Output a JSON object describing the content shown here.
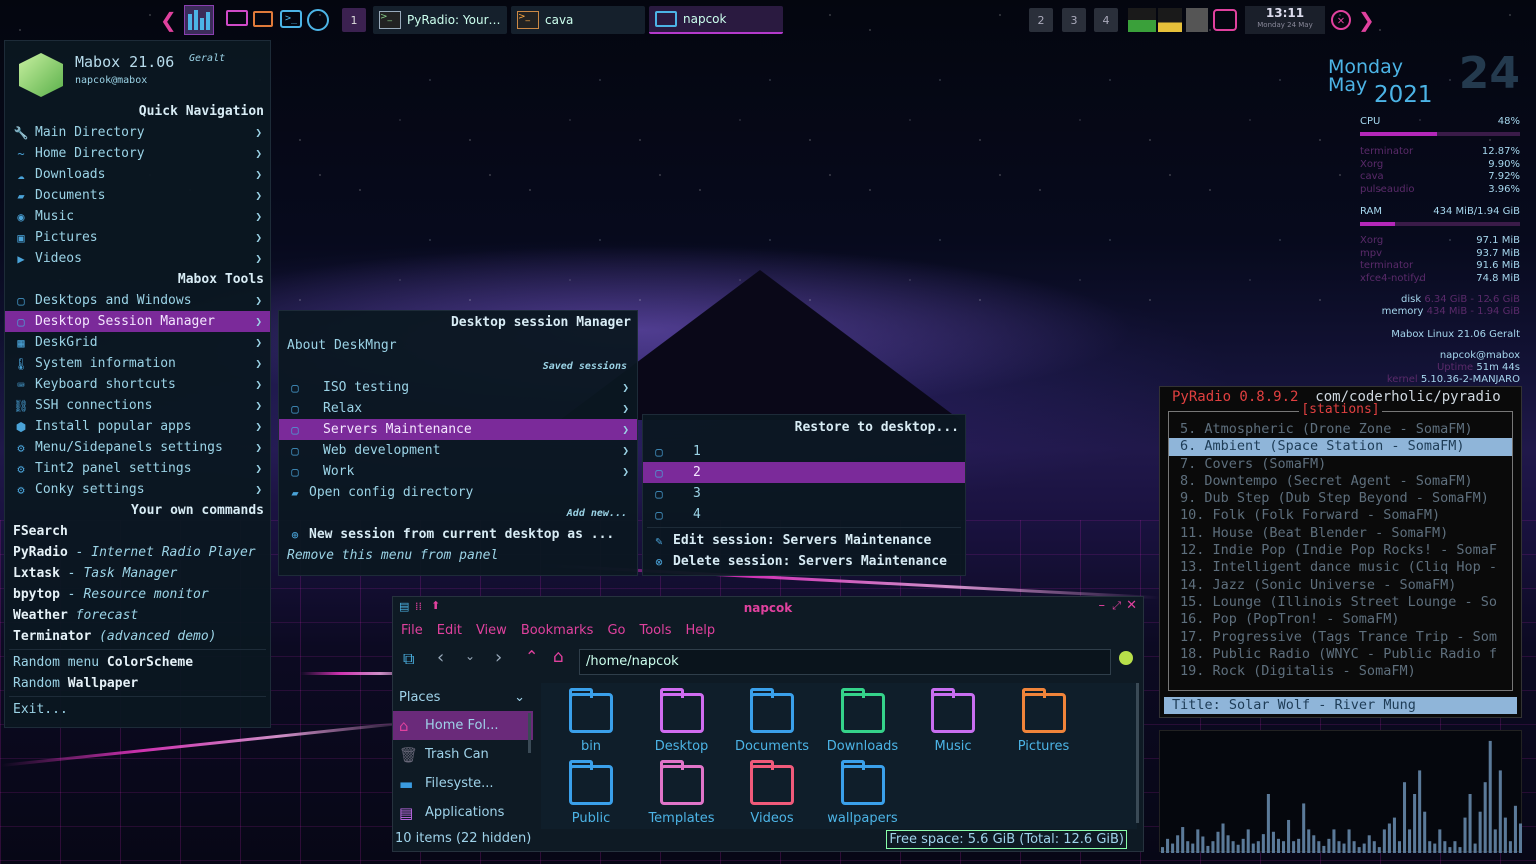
{
  "taskbar": {
    "desktop_num": "1",
    "tasks": [
      "PyRadio: Your…",
      "cava",
      "napcok"
    ],
    "desktops": [
      "2",
      "3",
      "4"
    ],
    "clock_time": "13:11",
    "clock_date": "Monday 24 May"
  },
  "menu": {
    "title": "Mabox 21.06",
    "codename": "Geralt",
    "user": "napcok@mabox",
    "quick_nav_header": "Quick Navigation",
    "quick_nav": [
      {
        "label": "Main Directory",
        "icon": "wrench-icon",
        "glyph": "🔧"
      },
      {
        "label": "Home Directory",
        "icon": "tilde-icon",
        "glyph": "~"
      },
      {
        "label": "Downloads",
        "icon": "cloud-download-icon",
        "glyph": "☁"
      },
      {
        "label": "Documents",
        "icon": "folder-icon",
        "glyph": "▰"
      },
      {
        "label": "Music",
        "icon": "music-icon",
        "glyph": "◉"
      },
      {
        "label": "Pictures",
        "icon": "picture-icon",
        "glyph": "▣"
      },
      {
        "label": "Videos",
        "icon": "video-icon",
        "glyph": "▶"
      }
    ],
    "tools_header": "Mabox Tools",
    "tools": [
      {
        "label": "Desktops and Windows",
        "icon": "window-icon",
        "glyph": "▢"
      },
      {
        "label": "Desktop Session Manager",
        "icon": "window-icon",
        "glyph": "▢",
        "selected": true
      },
      {
        "label": "DeskGrid",
        "icon": "grid-icon",
        "glyph": "▦"
      },
      {
        "label": "System information",
        "icon": "thermometer-icon",
        "glyph": "🌡"
      },
      {
        "label": "Keyboard shortcuts",
        "icon": "keyboard-icon",
        "glyph": "⌨"
      },
      {
        "label": "SSH connections",
        "icon": "network-icon",
        "glyph": "⛓"
      },
      {
        "label": "Install popular apps",
        "icon": "package-icon",
        "glyph": "⬢"
      },
      {
        "label": "Menu/Sidepanels settings",
        "icon": "cogs-icon",
        "glyph": "⚙"
      },
      {
        "label": "Tint2 panel settings",
        "icon": "cogs-icon",
        "glyph": "⚙"
      },
      {
        "label": "Conky settings",
        "icon": "cogs-icon",
        "glyph": "⚙"
      }
    ],
    "own_header": "Your own commands",
    "commands": [
      {
        "name": "FSearch",
        "desc": ""
      },
      {
        "name": "PyRadio",
        "desc": " - Internet Radio Player"
      },
      {
        "name": "Lxtask",
        "desc": " - Task Manager"
      },
      {
        "name": "bpytop",
        "desc": " - Resource monitor"
      },
      {
        "name": "Weather",
        "desc": " forecast"
      },
      {
        "name": "Terminator",
        "desc": " (advanced demo)"
      }
    ],
    "random_colorscheme_a": "Random menu ",
    "random_colorscheme_b": "ColorScheme",
    "random_wallpaper_a": "Random ",
    "random_wallpaper_b": "Wallpaper",
    "exit": "Exit..."
  },
  "session_menu": {
    "header": "Desktop session Manager",
    "about": "About DeskMngr",
    "saved_header": "Saved sessions",
    "sessions": [
      "ISO testing",
      "Relax",
      "Servers Maintenance",
      "Web development",
      "Work"
    ],
    "open_config": "Open config directory",
    "add_new": "Add new...",
    "new_session": "New session from current desktop as ...",
    "remove": "Remove this menu from panel"
  },
  "restore_menu": {
    "header": "Restore to desktop...",
    "desktops": [
      "1",
      "2",
      "3",
      "4"
    ],
    "edit": "Edit session: Servers Maintenance",
    "delete": "Delete session: Servers Maintenance"
  },
  "conky": {
    "day": "Monday",
    "month": "May",
    "year": "2021",
    "date": "24",
    "cpu_label": "CPU",
    "cpu_pct": "48%",
    "cpu_value": 48,
    "cpu_procs": [
      {
        "n": "terminator",
        "v": "12.87%"
      },
      {
        "n": "Xorg",
        "v": "9.90%"
      },
      {
        "n": "cava",
        "v": "7.92%"
      },
      {
        "n": "pulseaudio",
        "v": "3.96%"
      }
    ],
    "ram_label": "RAM",
    "ram_value_text": "434 MiB/1.94 GiB",
    "ram_value": 22,
    "ram_procs": [
      {
        "n": "Xorg",
        "v": "97.1 MiB"
      },
      {
        "n": "mpv",
        "v": "93.7 MiB"
      },
      {
        "n": "terminator",
        "v": "91.6 MiB"
      },
      {
        "n": "xfce4-notifyd",
        "v": "74.8 MiB"
      }
    ],
    "disk_label": "disk",
    "disk_val": "6.34 GiB - 12.6 GiB",
    "mem_label": "memory",
    "mem_val": "434 MiB - 1.94 GiB",
    "distro": "Mabox Linux 21.06 Geralt",
    "user": "napcok@mabox",
    "uptime_label": "Uptime",
    "uptime": "51m 44s",
    "kernel_label": "kernel",
    "kernel": "5.10.36-2-MANJARO"
  },
  "pyradio": {
    "title": "PyRadio 0.8.9.2",
    "url": "com/coderholic/pyradio",
    "stations_label": "[stations]",
    "stations": [
      " 5. Atmospheric (Drone Zone - SomaFM)",
      " 6. Ambient (Space Station - SomaFM)",
      " 7. Covers (SomaFM)",
      " 8. Downtempo (Secret Agent - SomaFM)",
      " 9. Dub Step (Dub Step Beyond - SomaFM)",
      "10. Folk (Folk Forward - SomaFM)",
      "11. House (Beat Blender - SomaFM)",
      "12. Indie Pop (Indie Pop Rocks! - SomaF",
      "13. Intelligent dance music (Cliq Hop -",
      "14. Jazz (Sonic Universe - SomaFM)",
      "15. Lounge (Illinois Street Lounge - So",
      "16. Pop (PopTron! - SomaFM)",
      "17. Progressive (Tags Trance Trip - Som",
      "18. Public Radio (WNYC - Public Radio f",
      "19. Rock (Digitalis - SomaFM)"
    ],
    "selected_index": 1,
    "now_playing": "Title: Solar Wolf - River Mung"
  },
  "cava_levels": [
    0.05,
    0.12,
    0.08,
    0.15,
    0.22,
    0.1,
    0.08,
    0.2,
    0.14,
    0.06,
    0.1,
    0.18,
    0.25,
    0.15,
    0.1,
    0.07,
    0.12,
    0.2,
    0.08,
    0.1,
    0.16,
    0.5,
    0.18,
    0.12,
    0.1,
    0.28,
    0.1,
    0.12,
    0.42,
    0.2,
    0.15,
    0.1,
    0.06,
    0.12,
    0.2,
    0.1,
    0.08,
    0.2,
    0.1,
    0.05,
    0.08,
    0.15,
    0.1,
    0.05,
    0.2,
    0.25,
    0.3,
    0.1,
    0.6,
    0.2,
    0.5,
    0.7,
    0.35,
    0.1,
    0.08,
    0.2,
    0.1,
    0.05,
    0.1,
    0.05,
    0.3,
    0.5,
    0.08,
    0.35,
    0.6,
    0.95,
    0.2,
    0.7,
    0.3,
    0.1,
    0.4,
    0.25
  ],
  "filemanager": {
    "title": "napcok",
    "menu": [
      "File",
      "Edit",
      "View",
      "Bookmarks",
      "Go",
      "Tools",
      "Help"
    ],
    "path": "/home/napcok",
    "places_label": "Places",
    "places": [
      {
        "label": "Home Fol...",
        "icon": "home-icon",
        "glyph": "⌂",
        "color": "#e0419e"
      },
      {
        "label": "Trash Can",
        "icon": "trash-icon",
        "glyph": "🗑",
        "color": "#667"
      },
      {
        "label": "Filesyste...",
        "icon": "drive-icon",
        "glyph": "▬",
        "color": "#3a9be0"
      },
      {
        "label": "Applications",
        "icon": "applications-icon",
        "glyph": "▤",
        "color": "#c86ef0"
      }
    ],
    "items": [
      {
        "name": "bin",
        "color": "#3aa0ea"
      },
      {
        "name": "Desktop",
        "color": "#d06cf0"
      },
      {
        "name": "Documents",
        "color": "#3aa0ea"
      },
      {
        "name": "Downloads",
        "color": "#35d38a"
      },
      {
        "name": "Music",
        "color": "#c86ef0"
      },
      {
        "name": "Pictures",
        "color": "#f0843a"
      },
      {
        "name": "Public",
        "color": "#3aa0ea"
      },
      {
        "name": "Templates",
        "color": "#e074c8"
      },
      {
        "name": "Videos",
        "color": "#f05a7a"
      },
      {
        "name": "wallpapers",
        "color": "#3aa0ea"
      }
    ],
    "status_left": "10 items (22 hidden)",
    "status_right": "Free space: 5.6 GiB (Total: 12.6 GiB)"
  }
}
